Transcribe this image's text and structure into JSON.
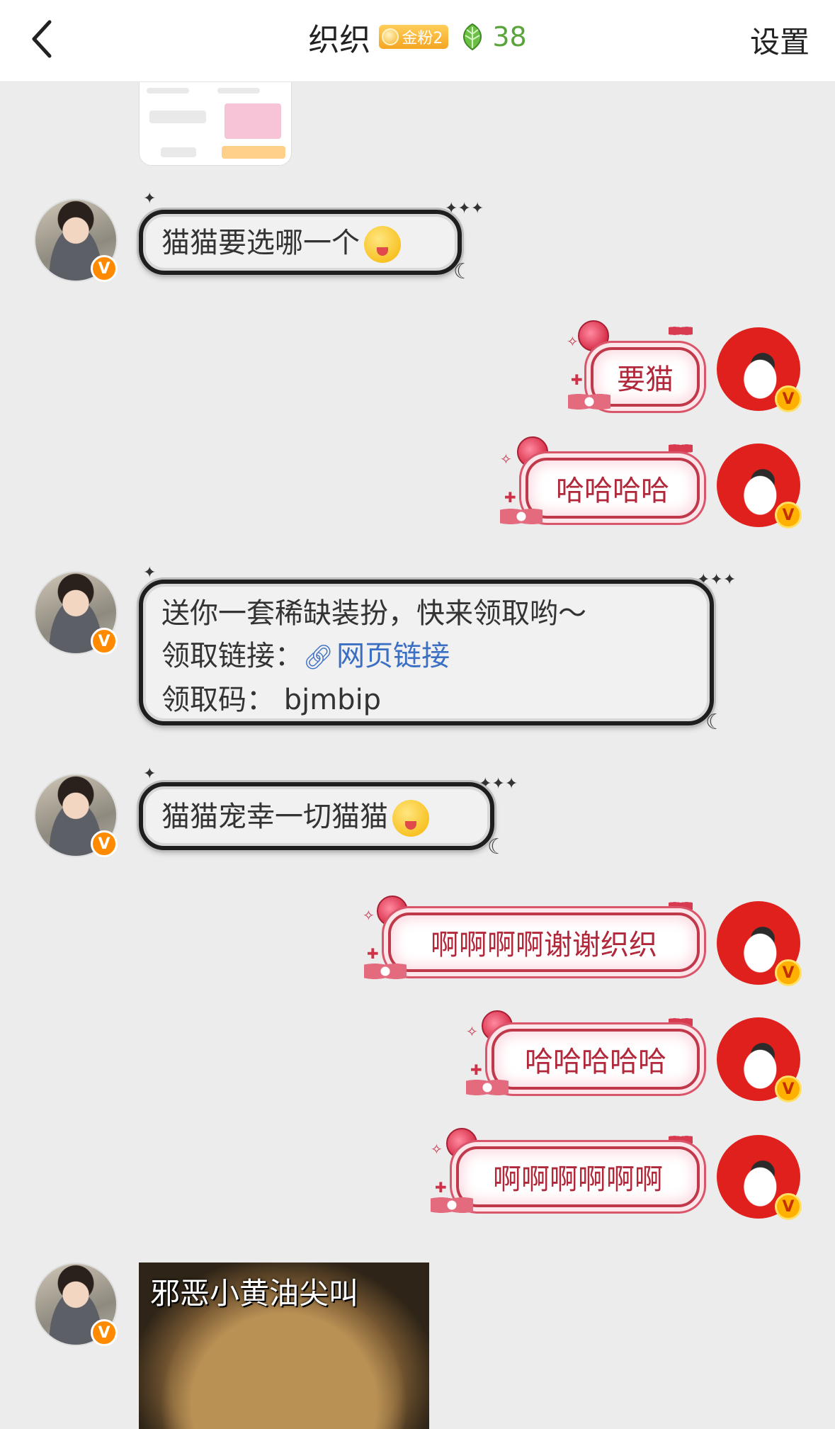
{
  "header": {
    "title": "织织",
    "fan_badge": "金粉2",
    "leaf_count": "38",
    "settings": "设置"
  },
  "messages": [
    {
      "side": "left",
      "text": "猫猫要选哪一个"
    },
    {
      "side": "right",
      "text": "要猫"
    },
    {
      "side": "right",
      "text": "哈哈哈哈"
    },
    {
      "side": "left",
      "line1": "送你一套稀缺装扮，快来领取哟～",
      "line2_label": "领取链接：",
      "line2_link": "网页链接",
      "line3": "领取码：  bjmbip"
    },
    {
      "side": "left",
      "text": "猫猫宠幸一切猫猫"
    },
    {
      "side": "right",
      "text": "啊啊啊啊谢谢织织"
    },
    {
      "side": "right",
      "text": "哈哈哈哈哈"
    },
    {
      "side": "right",
      "text": "啊啊啊啊啊啊"
    }
  ],
  "image_message": {
    "caption": "邪恶小黄油尖叫"
  },
  "badges": {
    "verified": "V"
  },
  "colors": {
    "header_bg": "#ffffff",
    "chat_bg": "#ececec",
    "self_text": "#b0283a",
    "link": "#3a6fc4",
    "leaf_green": "#5aa53b",
    "verified_orange": "#ff8a00"
  }
}
